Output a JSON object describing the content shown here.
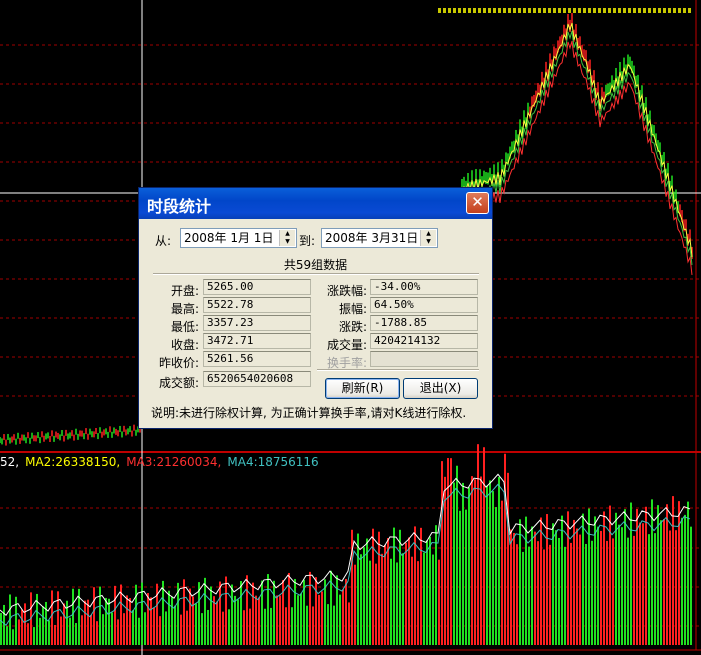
{
  "ma_legend": {
    "ma1": "52,",
    "ma2": "MA2:26338150,",
    "ma3": "MA3:21260034,",
    "ma4": "MA4:18756116",
    "colors": {
      "ma1": "#ffffff",
      "ma2": "#ffff00",
      "ma3": "#ff3030",
      "ma4": "#40c0c0"
    }
  },
  "dialog": {
    "title": "时段统计",
    "close_glyph": "✕",
    "from_label": "从:",
    "from_date": "2008年  1月  1日",
    "to_label": "到:",
    "to_date": "2008年  3月31日",
    "summary": "共59组数据",
    "left_fields": [
      {
        "label": "开盘:",
        "value": "5265.00"
      },
      {
        "label": "最高:",
        "value": "5522.78"
      },
      {
        "label": "最低:",
        "value": "3357.23"
      },
      {
        "label": "收盘:",
        "value": "3472.71"
      },
      {
        "label": "昨收价:",
        "value": "5261.56"
      },
      {
        "label": "成交额:",
        "value": "6520654020608"
      }
    ],
    "right_fields": [
      {
        "label": "涨跌幅:",
        "value": "-34.00%"
      },
      {
        "label": "振幅:",
        "value": "64.50%"
      },
      {
        "label": "涨跌:",
        "value": "-1788.85"
      },
      {
        "label": "成交量:",
        "value": "4204214132"
      },
      {
        "label": "换手率:",
        "value": ""
      }
    ],
    "refresh_button": "刷新(R)",
    "exit_button": "退出(X)",
    "note": "说明:未进行除权计算, 为正确计算换手率,请对K线进行除权."
  }
}
